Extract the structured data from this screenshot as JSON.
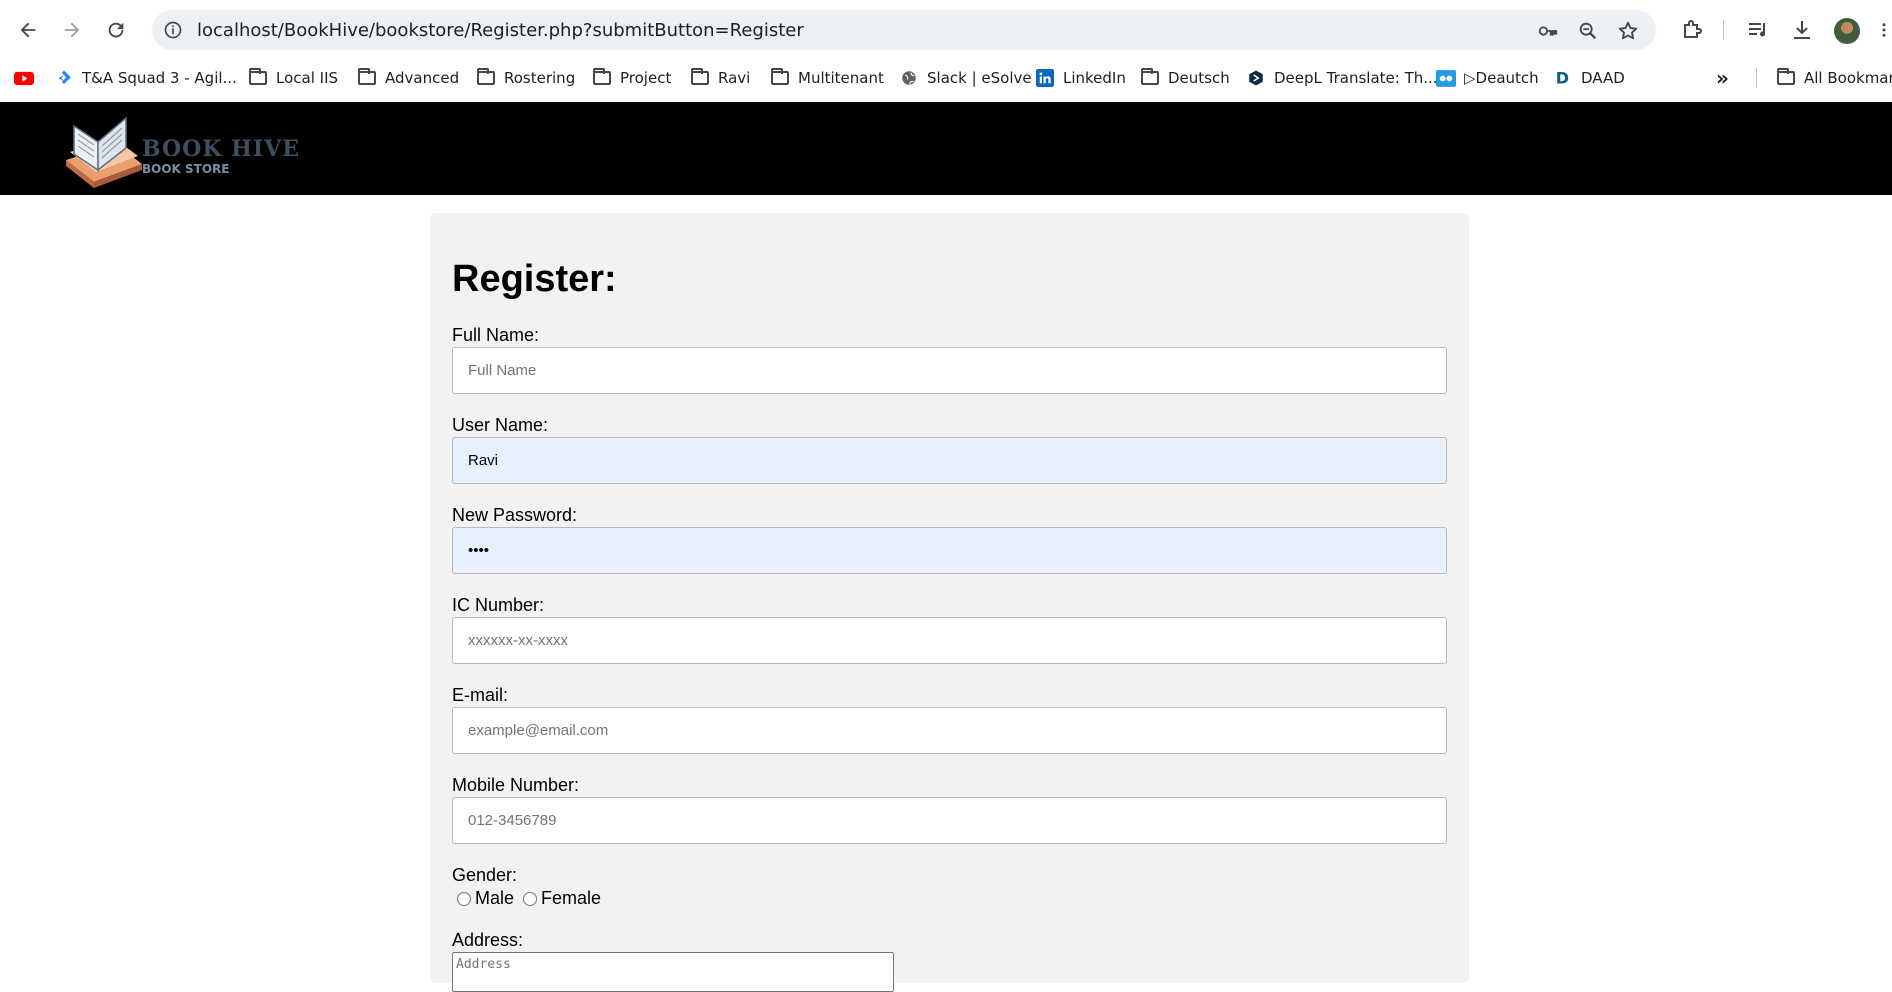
{
  "browser": {
    "url": "localhost/BookHive/bookstore/Register.php?submitButton=Register",
    "bookmarks": [
      {
        "label": "T&A Squad 3 - Agil...",
        "icon": "jira-icon"
      },
      {
        "label": "Local IIS",
        "icon": "folder-icon"
      },
      {
        "label": "Advanced",
        "icon": "folder-icon"
      },
      {
        "label": "Rostering",
        "icon": "folder-icon"
      },
      {
        "label": "Project",
        "icon": "folder-icon"
      },
      {
        "label": "Ravi",
        "icon": "folder-icon"
      },
      {
        "label": "Multitenant",
        "icon": "folder-icon"
      },
      {
        "label": "Slack | eSolve",
        "icon": "globe-icon"
      },
      {
        "label": "LinkedIn",
        "icon": "linkedin-icon"
      },
      {
        "label": "Deutsch",
        "icon": "folder-icon"
      },
      {
        "label": "DeepL Translate: Th...",
        "icon": "deepl-icon"
      },
      {
        "label": "▷Deautch",
        "icon": "deautch-icon"
      },
      {
        "label": "DAAD",
        "icon": "daad-icon"
      }
    ],
    "all_bookmarks": "All Bookmarks"
  },
  "site": {
    "brand": "BOOK HIVE",
    "sub": "BOOK STORE"
  },
  "form": {
    "title": "Register:",
    "full_name": {
      "label": "Full Name:",
      "placeholder": "Full Name",
      "value": ""
    },
    "user_name": {
      "label": "User Name:",
      "placeholder": "",
      "value": "Ravi"
    },
    "password": {
      "label": "New Password:",
      "value": "••••"
    },
    "ic_number": {
      "label": "IC Number:",
      "placeholder": "xxxxxx-xx-xxxx",
      "value": ""
    },
    "email": {
      "label": "E-mail:",
      "placeholder": "example@email.com",
      "value": ""
    },
    "mobile": {
      "label": "Mobile Number:",
      "placeholder": "012-3456789",
      "value": ""
    },
    "gender": {
      "label": "Gender:",
      "options": [
        "Male",
        "Female"
      ]
    },
    "address": {
      "label": "Address:",
      "placeholder": "Address"
    }
  }
}
